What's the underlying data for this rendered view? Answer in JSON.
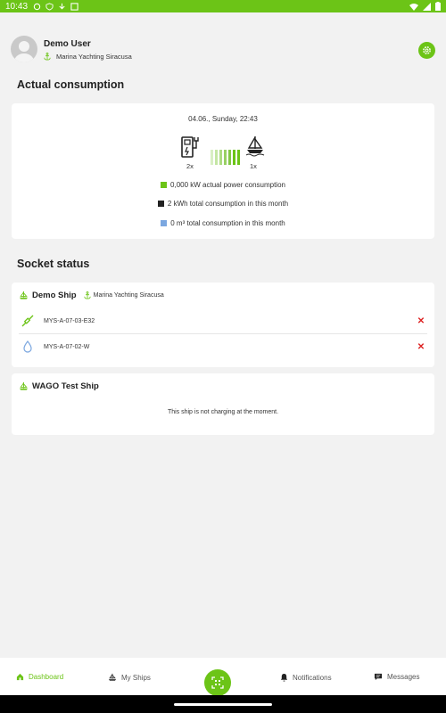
{
  "status_bar": {
    "time": "10:43"
  },
  "profile": {
    "name": "Demo User",
    "marina": "Marina Yachting Siracusa"
  },
  "consumption": {
    "title": "Actual consumption",
    "datetime": "04.06., Sunday, 22:43",
    "charger_count": "2x",
    "ship_count": "1x",
    "legend": [
      {
        "color": "#6cc417",
        "text": "0,000 kW actual power consumption"
      },
      {
        "color": "#222222",
        "text": "2 kWh total consumption in this month"
      },
      {
        "color": "#7ba7e0",
        "text": "0 m³ total consumption in this month"
      }
    ]
  },
  "socket_status": {
    "title": "Socket status",
    "ships": [
      {
        "name": "Demo Ship",
        "marina": "Marina Yachting Siracusa",
        "sockets": [
          {
            "id": "MYS-A-07-03-E32",
            "type": "power-plug-icon"
          },
          {
            "id": "MYS-A-07-02-W",
            "type": "water-drop-icon"
          }
        ]
      },
      {
        "name": "WAGO Test Ship",
        "message": "This ship is not charging at the moment."
      }
    ]
  },
  "nav": {
    "dashboard": "Dashboard",
    "my_ships": "My Ships",
    "notifications": "Notifications",
    "messages": "Messages"
  },
  "colors": {
    "accent": "#6cc417",
    "danger": "#dd2222"
  }
}
